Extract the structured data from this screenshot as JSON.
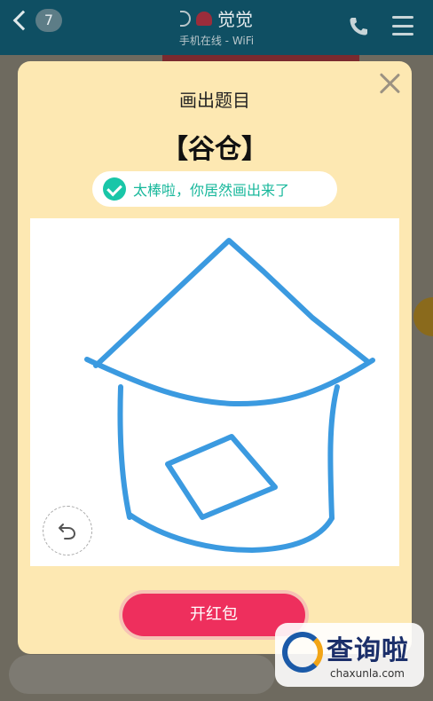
{
  "chat": {
    "unread_count": "7",
    "contact_name": "觉觉",
    "status": "手机在线 - WiFi"
  },
  "modal": {
    "heading": "画出题目",
    "answer": "【谷仓】",
    "success_message": "太棒啦，你居然画出来了",
    "red_packet_button": "开红包"
  },
  "icons": {
    "back": "chevron-left-icon",
    "phone": "phone-icon",
    "menu": "menu-icon",
    "close": "close-icon",
    "check": "check-icon",
    "undo": "undo-icon"
  },
  "colors": {
    "header_bg": "#0f4f63",
    "modal_bg": "#fde8b2",
    "stroke": "#3b9ae0",
    "success": "#19c6a8",
    "button": "#ee2f5d"
  },
  "watermark": {
    "brand": "查询啦",
    "url": "chaxunla.com"
  }
}
